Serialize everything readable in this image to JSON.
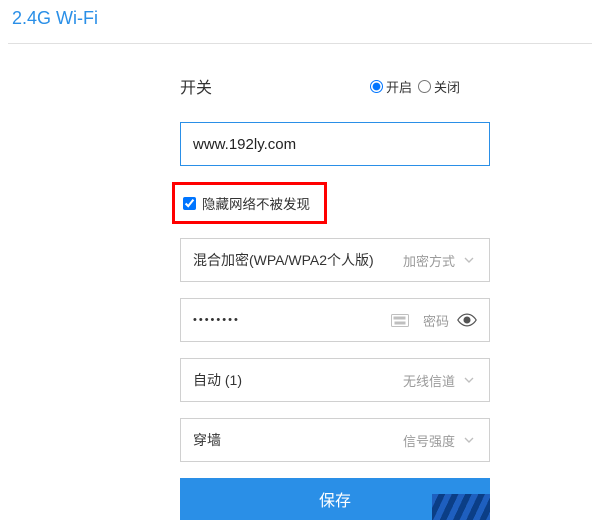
{
  "title": "2.4G Wi-Fi",
  "switch": {
    "label": "开关",
    "on": "开启",
    "off": "关闭",
    "value": "on"
  },
  "ssid": {
    "value": "www.192ly.com"
  },
  "hide_network": {
    "label": "隐藏网络不被发现",
    "checked": true
  },
  "encryption": {
    "value": "混合加密(WPA/WPA2个人版)",
    "suffix": "加密方式"
  },
  "password": {
    "masked": "••••••••",
    "suffix": "密码"
  },
  "channel": {
    "value": "自动 (1)",
    "suffix": "无线信道"
  },
  "signal": {
    "value": "穿墙",
    "suffix": "信号强度"
  },
  "save_label": "保存"
}
